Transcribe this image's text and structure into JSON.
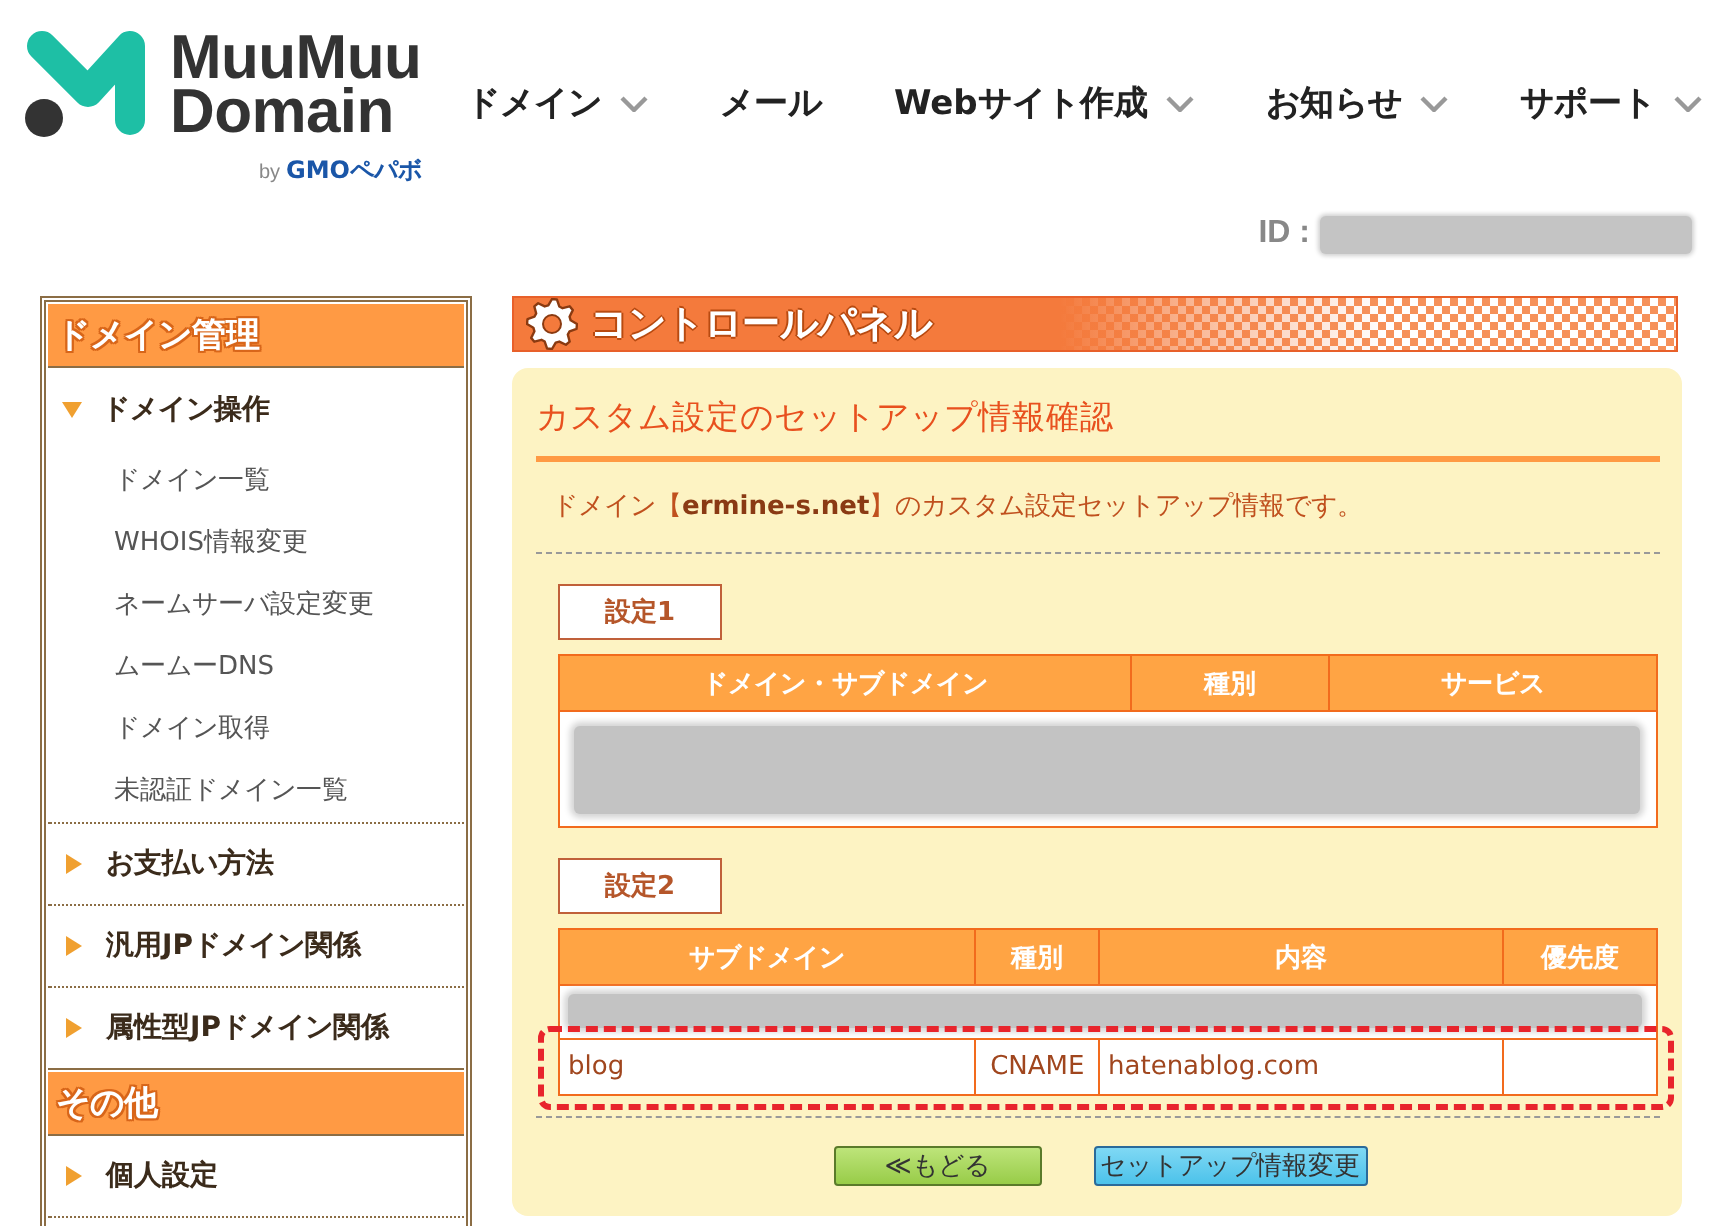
{
  "header": {
    "logo": {
      "wordmark": [
        "MuuMuu",
        "Domain"
      ],
      "byline": "by",
      "brand": "GMOペパボ"
    },
    "nav": [
      {
        "label": "ドメイン",
        "has_menu": true
      },
      {
        "label": "メール",
        "has_menu": false
      },
      {
        "label": "Webサイト作成",
        "has_menu": true
      },
      {
        "label": "お知らせ",
        "has_menu": true
      },
      {
        "label": "サポート",
        "has_menu": true
      }
    ],
    "account": {
      "id_label": "ID :"
    }
  },
  "sidebar": {
    "sections": [
      {
        "title": "ドメイン管理",
        "items": [
          {
            "label": "ドメイン操作",
            "expanded": true,
            "children": [
              {
                "label": "ドメイン一覧"
              },
              {
                "label": "WHOIS情報変更"
              },
              {
                "label": "ネームサーバ設定変更"
              },
              {
                "label": "ムームーDNS"
              },
              {
                "label": "ドメイン取得"
              },
              {
                "label": "未認証ドメイン一覧"
              }
            ]
          },
          {
            "label": "お支払い方法",
            "expanded": false
          },
          {
            "label": "汎用JPドメイン関係",
            "expanded": false
          },
          {
            "label": "属性型JPドメイン関係",
            "expanded": false
          }
        ]
      },
      {
        "title": "その他",
        "items": [
          {
            "label": "個人設定",
            "expanded": false
          }
        ]
      }
    ]
  },
  "main": {
    "banner": "コントロールパネル",
    "title": "カスタム設定のセットアップ情報確認",
    "description": "ドメイン【**ermine-s.net**】のカスタム設定セットアップ情報です。",
    "settings": [
      {
        "label": "設定1",
        "columns": [
          "ドメイン・サブドメイン",
          "種別",
          "サービス"
        ],
        "rows": [
          {
            "kind": "redacted",
            "highlighted": false
          }
        ]
      },
      {
        "label": "設定2",
        "columns": [
          "サブドメイン",
          "種別",
          "内容",
          "優先度"
        ],
        "rows": [
          {
            "kind": "redacted",
            "highlighted": false
          },
          {
            "kind": "record",
            "cells": [
              "blog",
              "CNAME",
              "hatenablog.com"
            ],
            "highlighted": true
          }
        ]
      }
    ],
    "buttons": [
      {
        "label": "≪もどる",
        "kind": "back"
      },
      {
        "label": "セットアップ情報変更",
        "kind": "change"
      }
    ]
  }
}
